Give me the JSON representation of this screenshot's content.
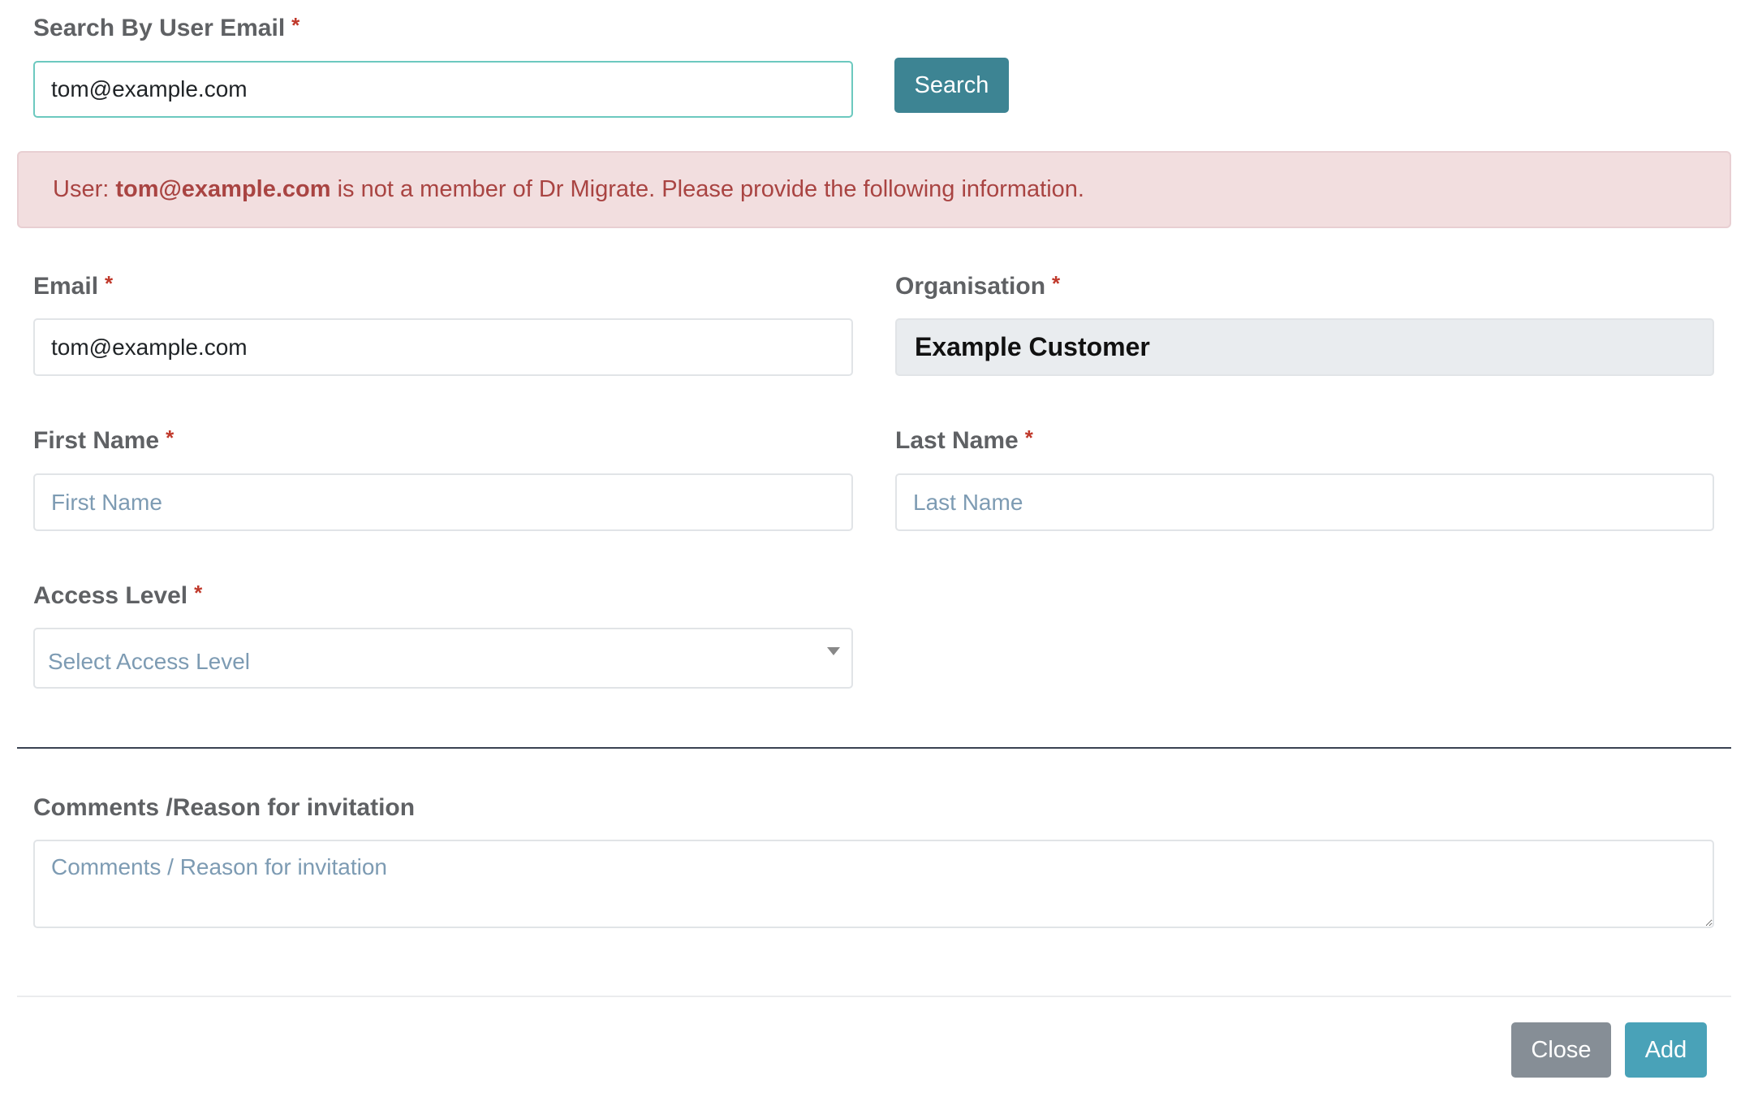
{
  "search": {
    "label": "Search By User Email",
    "required_marker": "*",
    "value": "tom@example.com",
    "button_label": "Search"
  },
  "alert": {
    "prefix": "User: ",
    "email": "tom@example.com",
    "suffix": " is not a member of Dr Migrate. Please provide the following information."
  },
  "form": {
    "email": {
      "label": "Email",
      "required_marker": "*",
      "value": "tom@example.com"
    },
    "organisation": {
      "label": "Organisation",
      "required_marker": "*",
      "value": "Example Customer"
    },
    "first_name": {
      "label": "First Name",
      "required_marker": "*",
      "placeholder": "First Name",
      "value": ""
    },
    "last_name": {
      "label": "Last Name",
      "required_marker": "*",
      "placeholder": "Last Name",
      "value": ""
    },
    "access_level": {
      "label": "Access Level",
      "required_marker": "*",
      "selected": "Select Access Level"
    },
    "comments": {
      "label": "Comments /Reason for invitation",
      "placeholder": "Comments / Reason for invitation",
      "value": ""
    }
  },
  "footer": {
    "close_label": "Close",
    "add_label": "Add"
  },
  "colors": {
    "search_button": "#3d8493",
    "close_button": "#868e96",
    "add_button": "#49a2b8",
    "alert_text": "#a94442",
    "alert_bg": "#f2dedf",
    "required": "#c0392b",
    "focus_border": "#6cc9bf"
  }
}
